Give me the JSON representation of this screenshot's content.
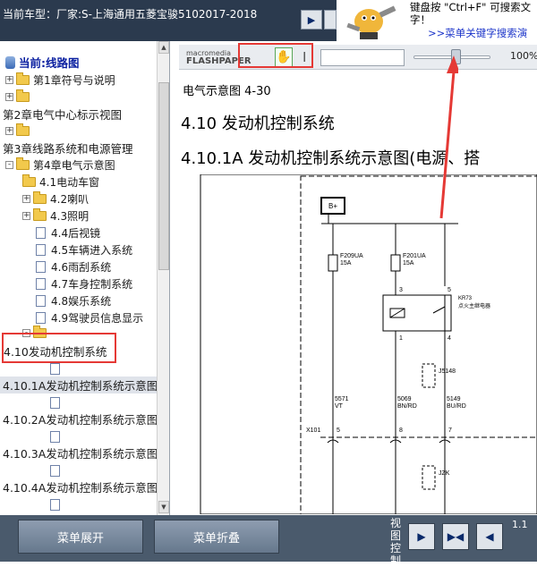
{
  "header": {
    "title": "当前车型：厂家:S-上海通用五菱宝骏5102017-2018",
    "nav_next": "▶",
    "nav_fit": "◀▶"
  },
  "ad": {
    "line1": "键盘按 \"Ctrl+F\" 可搜索文",
    "line2": "字！",
    "link": ">>菜单关键字搜索演"
  },
  "tree": {
    "root": "当前:线路图",
    "items": [
      {
        "label": "第1章符号与说明",
        "icon": "folder-icon",
        "toggle": "+"
      },
      {
        "label": "",
        "icon": "folder-icon",
        "toggle": "+"
      },
      {
        "label": "第2章电气中心标示视图",
        "icon": "",
        "toggle": ""
      },
      {
        "label": "",
        "icon": "folder-icon",
        "toggle": "+"
      },
      {
        "label": "第3章线路系统和电源管理",
        "icon": "",
        "toggle": ""
      },
      {
        "label": "第4章电气示意图",
        "icon": "folder-open-icon",
        "toggle": "-"
      },
      {
        "label": "4.1电动车窗",
        "icon": "folder-icon",
        "toggle": ""
      },
      {
        "label": "4.2喇叭",
        "icon": "folder-icon",
        "toggle": "+"
      },
      {
        "label": "4.3照明",
        "icon": "folder-icon",
        "toggle": "+"
      },
      {
        "label": "4.4后视镜",
        "icon": "page-icon",
        "toggle": ""
      },
      {
        "label": "4.5车辆进入系统",
        "icon": "page-icon",
        "toggle": ""
      },
      {
        "label": "4.6雨刮系统",
        "icon": "page-icon",
        "toggle": ""
      },
      {
        "label": "4.7车身控制系统",
        "icon": "page-icon",
        "toggle": ""
      },
      {
        "label": "4.8娱乐系统",
        "icon": "page-icon",
        "toggle": ""
      },
      {
        "label": "4.9驾驶员信息显示",
        "icon": "page-icon",
        "toggle": ""
      },
      {
        "label": "",
        "icon": "folder-open-icon",
        "toggle": "-"
      },
      {
        "label": "4.10发动机控制系统",
        "icon": "",
        "toggle": ""
      },
      {
        "label": "",
        "icon": "page-icon",
        "toggle": ""
      },
      {
        "label": "4.10.1A发动机控制系统示意图",
        "icon": "",
        "toggle": ""
      },
      {
        "label": "",
        "icon": "page-icon",
        "toggle": ""
      },
      {
        "label": "4.10.2A发动机控制系统示意图",
        "icon": "",
        "toggle": ""
      },
      {
        "label": "",
        "icon": "page-icon",
        "toggle": ""
      },
      {
        "label": "4.10.3A发动机控制系统示意图",
        "icon": "",
        "toggle": ""
      },
      {
        "label": "",
        "icon": "page-icon",
        "toggle": ""
      },
      {
        "label": "4.10.4A发动机控制系统示意图",
        "icon": "",
        "toggle": ""
      },
      {
        "label": "",
        "icon": "page-icon",
        "toggle": ""
      }
    ]
  },
  "toolbar": {
    "brand_top": "macromedia",
    "brand_bottom": "FLASHPAPER",
    "hand_icon": "hand-icon",
    "zoom": "100%"
  },
  "document": {
    "subtitle": "电气示意图 4-30",
    "heading": "4.10 发动机控制系统",
    "subheading": "4.10.1A 发动机控制系统示意图(电源、搭"
  },
  "diagram": {
    "bplus": "B+",
    "fuse1_name": "F209UA",
    "fuse1_amp": "15A",
    "fuse2_name": "F201UA",
    "fuse2_amp": "15A",
    "relay_pin3": "3",
    "relay_pin5": "5",
    "relay_pin1": "1",
    "relay_pin4": "4",
    "relay_name": "KR73",
    "relay_desc": "点火主继电器",
    "conn1": "J5148",
    "wire1_id": "5571",
    "wire1_color": "VT",
    "wire2_id": "5069",
    "wire2_color": "BN/RD",
    "wire3_id": "5149",
    "wire3_color": "BU/RD",
    "x101": "X101",
    "x_pin1": "5",
    "x_pin2": "8",
    "x_pin3": "7",
    "conn2": "JZK"
  },
  "bottom": {
    "expand": "菜单展开",
    "collapse": "菜单折叠",
    "view_label": "视图控制",
    "ratio": "1.1"
  },
  "colors": {
    "highlight": "#e53935",
    "topbar": "#2b3a4e",
    "bottombar": "#4a5a6c"
  }
}
